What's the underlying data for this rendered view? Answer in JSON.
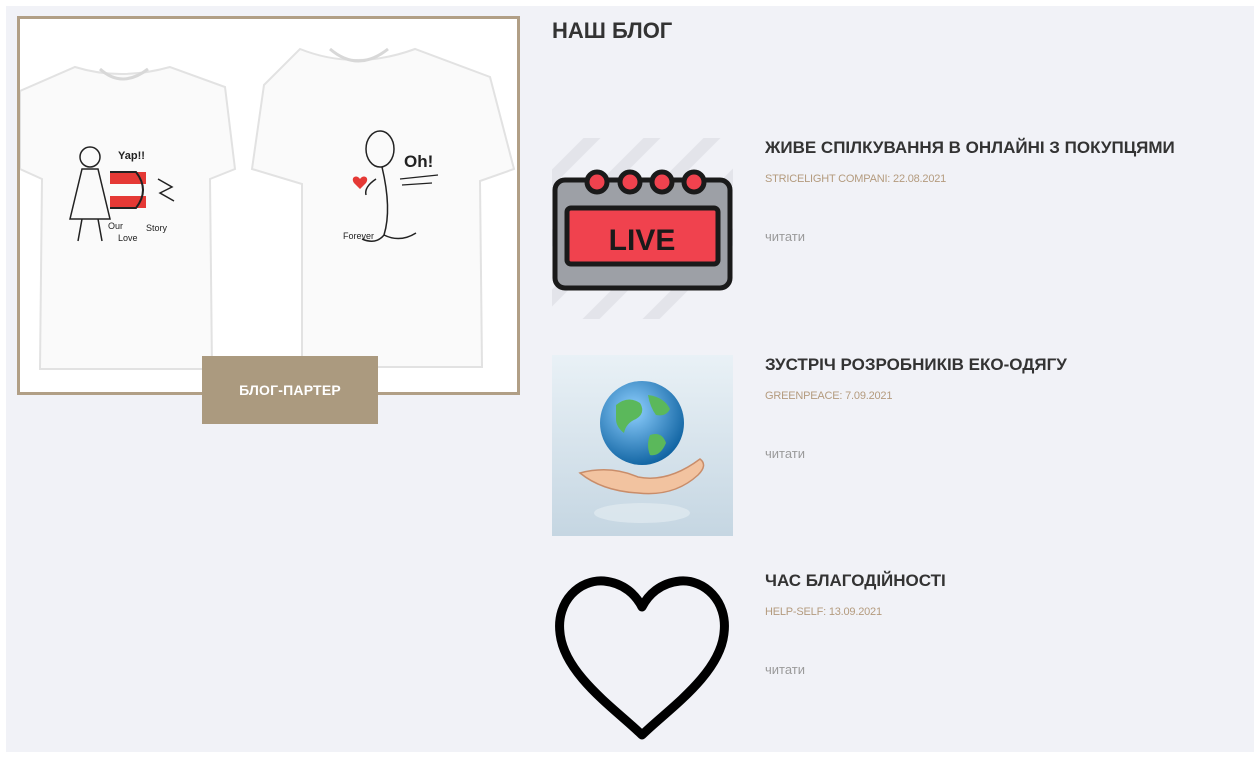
{
  "feature": {
    "shirt_left_texts": [
      "Yap!!",
      "Our",
      "Love",
      "Story"
    ],
    "shirt_right_texts": [
      "Oh!",
      "Forever"
    ],
    "button_label": "БЛОГ-ПАРТЕР"
  },
  "blog": {
    "title": "НАШ БЛОГ",
    "posts": [
      {
        "title": "ЖИВЕ СПІЛКУВАННЯ В ОНЛАЙНІ З ПОКУПЦЯМИ",
        "meta": "STRICELIGHT COMPANI: 22.08.2021",
        "read_label": "читати",
        "thumb_text": "LIVE"
      },
      {
        "title": "ЗУСТРІЧ РОЗРОБНИКІВ ЕКО-ОДЯГУ",
        "meta": "GREENPEACE: 7.09.2021",
        "read_label": "читати"
      },
      {
        "title": "ЧАС БЛАГОДІЙНОСТІ",
        "meta": "HELP-SELF: 13.09.2021",
        "read_label": "читати"
      }
    ]
  },
  "colors": {
    "accent": "#ab9a7f",
    "background": "#f1f2f7",
    "meta": "#b49b7e",
    "live_red": "#f0424e"
  },
  "icons": [
    "tshirt-couple-image",
    "live-sign-icon",
    "globe-in-hand-icon",
    "heart-outline-icon"
  ]
}
